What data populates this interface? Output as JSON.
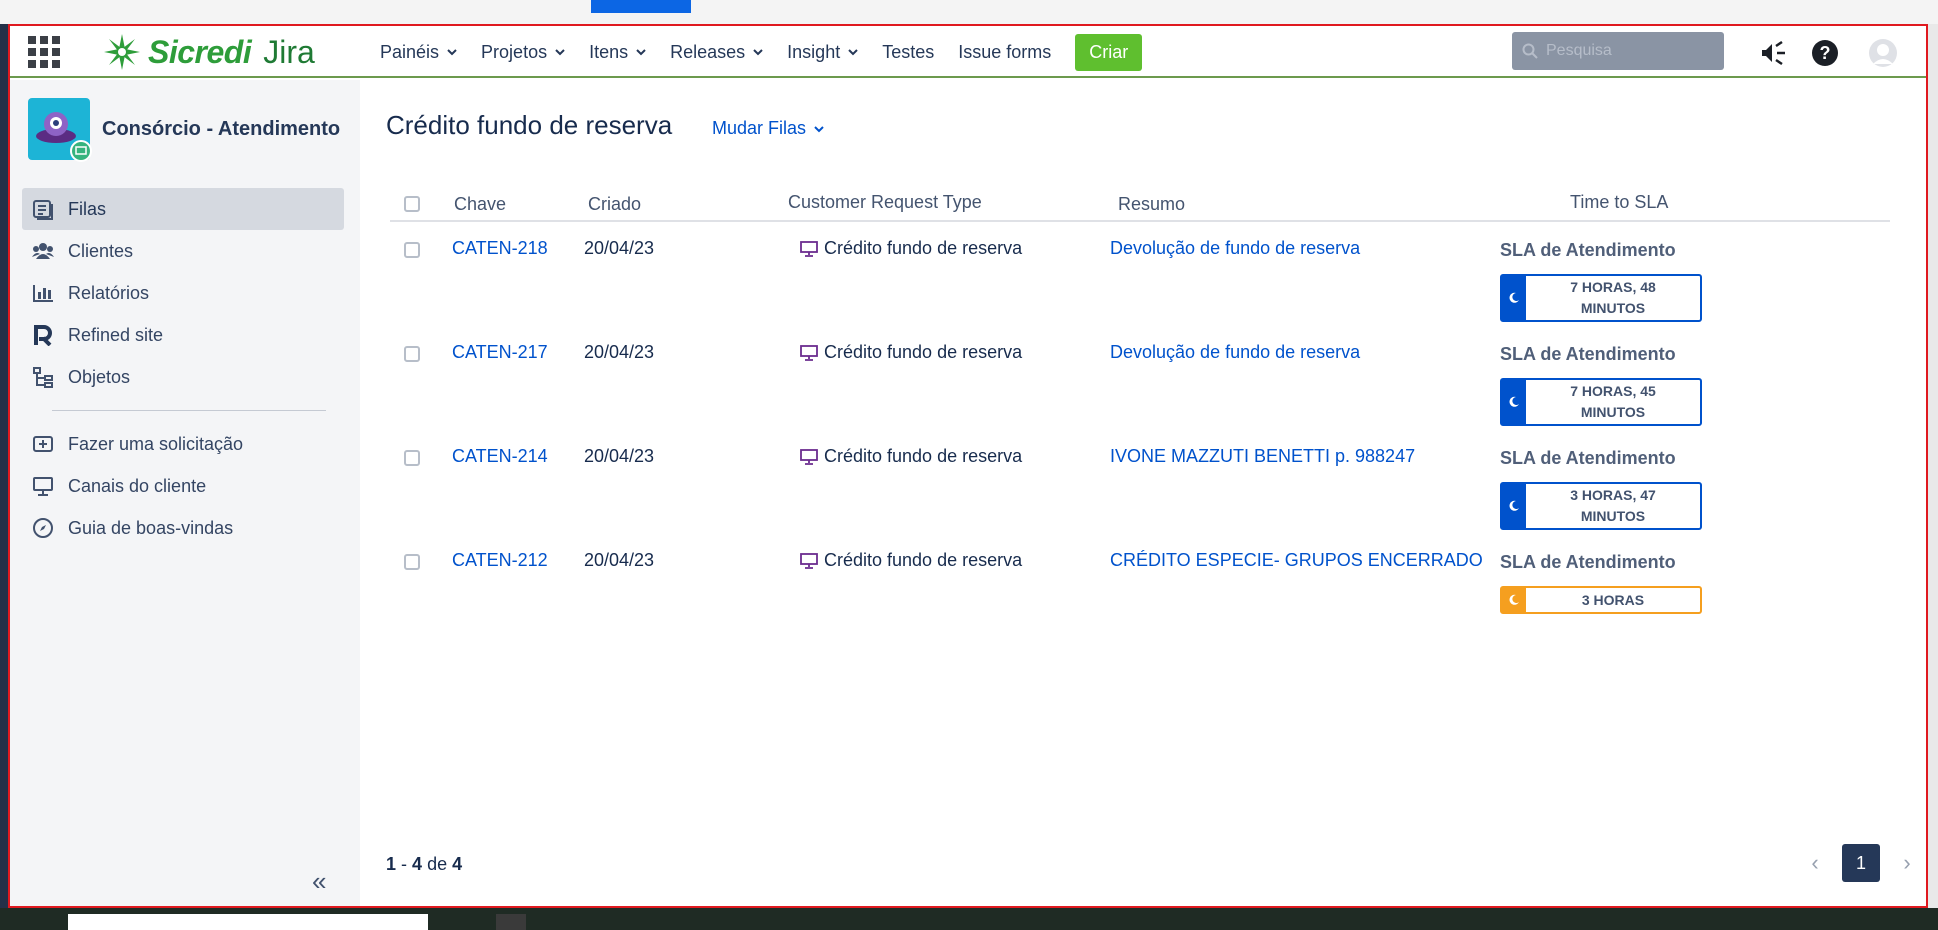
{
  "nav": {
    "brand": "Sicredi",
    "product": "Jira",
    "menu": [
      {
        "label": "Painéis",
        "dropdown": true
      },
      {
        "label": "Projetos",
        "dropdown": true
      },
      {
        "label": "Itens",
        "dropdown": true
      },
      {
        "label": "Releases",
        "dropdown": true
      },
      {
        "label": "Insight",
        "dropdown": true
      },
      {
        "label": "Testes",
        "dropdown": false
      },
      {
        "label": "Issue forms",
        "dropdown": false
      }
    ],
    "create_label": "Criar",
    "search_placeholder": "Pesquisa",
    "colors": {
      "brand_green": "#2e9d3a",
      "create_green": "#5fbf2f"
    }
  },
  "sidebar": {
    "project_name": "Consórcio - Atendimento",
    "items": [
      {
        "label": "Filas",
        "icon": "queues-icon",
        "active": true
      },
      {
        "label": "Clientes",
        "icon": "customers-icon",
        "active": false
      },
      {
        "label": "Relatórios",
        "icon": "reports-icon",
        "active": false
      },
      {
        "label": "Refined site",
        "icon": "refined-icon",
        "active": false
      },
      {
        "label": "Objetos",
        "icon": "objects-icon",
        "active": false
      }
    ],
    "items2": [
      {
        "label": "Fazer uma solicitação",
        "icon": "add-request-icon"
      },
      {
        "label": "Canais do cliente",
        "icon": "monitor-icon"
      },
      {
        "label": "Guia de boas-vindas",
        "icon": "compass-icon"
      }
    ]
  },
  "main": {
    "title": "Crédito fundo de reserva",
    "switch_label": "Mudar Filas",
    "columns": [
      "Chave",
      "Criado",
      "Customer Request Type",
      "Resumo",
      "Time to SLA"
    ],
    "rows": [
      {
        "key": "CATEN-218",
        "created": "20/04/23",
        "type": "Crédito fundo de reserva",
        "summary": "Devolução de fundo de reserva",
        "sla_title": "SLA de Atendimento",
        "sla_line1": "7 HORAS, 48",
        "sla_line2": "MINUTOS",
        "sla_status": "ok"
      },
      {
        "key": "CATEN-217",
        "created": "20/04/23",
        "type": "Crédito fundo de reserva",
        "summary": "Devolução de fundo de reserva",
        "sla_title": "SLA de Atendimento",
        "sla_line1": "7 HORAS, 45",
        "sla_line2": "MINUTOS",
        "sla_status": "ok"
      },
      {
        "key": "CATEN-214",
        "created": "20/04/23",
        "type": "Crédito fundo de reserva",
        "summary": "IVONE MAZZUTI BENETTI p. 988247",
        "sla_title": "SLA de Atendimento",
        "sla_line1": "3 HORAS, 47",
        "sla_line2": "MINUTOS",
        "sla_status": "ok"
      },
      {
        "key": "CATEN-212",
        "created": "20/04/23",
        "type": "Crédito fundo de reserva",
        "summary": "CRÉDITO ESPECIE- GRUPOS ENCERRADO",
        "sla_title": "SLA de Atendimento",
        "sla_line1": "3 HORAS",
        "sla_line2": "",
        "sla_status": "warn"
      }
    ],
    "pagination": {
      "from": "1",
      "to": "4",
      "sep": "-",
      "of_label": "de",
      "total": "4",
      "current_page": "1"
    }
  }
}
